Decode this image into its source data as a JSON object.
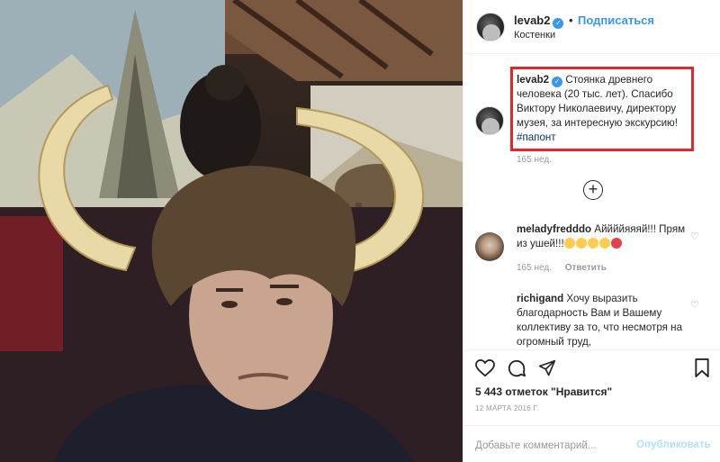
{
  "post": {
    "username": "levab2",
    "follow_label": "Подписаться",
    "separator": "•",
    "location": "Костенки",
    "verified_glyph": "✓"
  },
  "caption": {
    "username": "levab2",
    "text": "Стоянка древнего человека (20 тыс. лет). Спасибо Виктору Николаевичу, директору музея, за интересную экскурсию!",
    "hashtag": "#папонт",
    "time": "165 нед."
  },
  "load_more_glyph": "+",
  "comments": [
    {
      "username": "meladyfredddo",
      "text": "Аййййяяяй!!! Прям из ушей!!!",
      "time": "165 нед.",
      "reply_label": "Ответить"
    },
    {
      "username": "richigand",
      "text": "Хочу выразить благодарность Вам и Вашему коллективу за то, что несмотря на огромный труд,"
    }
  ],
  "likes": "5 443 отметок \"Нравится\"",
  "date": "12 МАРТА 2016 Г.",
  "comment_input": {
    "placeholder": "Добавьте комментарий...",
    "post_label": "Опубликовать"
  },
  "icons": {
    "verified": "verified-badge-icon",
    "load_more": "plus-circle-icon",
    "like": "heart-icon",
    "comment": "speech-bubble-icon",
    "share": "paper-plane-icon",
    "save": "bookmark-icon"
  },
  "colors": {
    "accent": "#3897f0",
    "highlight_box": "#e3262c",
    "muted": "#999999",
    "hashtag": "#003569"
  }
}
